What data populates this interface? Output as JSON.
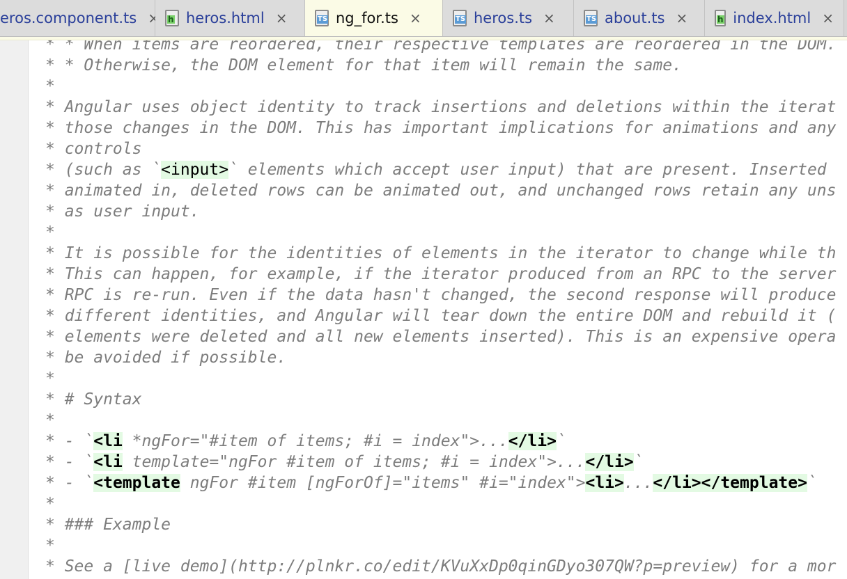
{
  "tabs": [
    {
      "label": "eros.component.ts",
      "icon": "none",
      "active": false
    },
    {
      "label": "heros.html",
      "icon": "html",
      "active": false
    },
    {
      "label": "ng_for.ts",
      "icon": "ts",
      "active": true
    },
    {
      "label": "heros.ts",
      "icon": "ts",
      "active": false
    },
    {
      "label": "about.ts",
      "icon": "ts",
      "active": false
    },
    {
      "label": "index.html",
      "icon": "html",
      "active": false
    }
  ],
  "close_glyph": "×",
  "icon_labels": {
    "ts": "TS",
    "html": "h"
  },
  "colors": {
    "comment": "#7d7d7d",
    "tag_bg": "#e3fae3",
    "active_tab": "#fbfbe6"
  },
  "lines": [
    [
      {
        "t": "* * When items are reordered, their respective templates are reordered in the DOM.",
        "k": "c"
      }
    ],
    [
      {
        "t": "* * Otherwise, the DOM element for that item will remain the same.",
        "k": "c"
      }
    ],
    [
      {
        "t": "*",
        "k": "c"
      }
    ],
    [
      {
        "t": "* Angular uses object identity to track insertions and deletions within the iterat",
        "k": "c"
      }
    ],
    [
      {
        "t": "* those changes in the DOM. This has important implications for animations and any",
        "k": "c"
      }
    ],
    [
      {
        "t": "* controls",
        "k": "c"
      }
    ],
    [
      {
        "t": "* (such as `",
        "k": "c"
      },
      {
        "t": "<input>",
        "k": "tag"
      },
      {
        "t": "` elements which accept user input) that are present. Inserted ",
        "k": "c"
      }
    ],
    [
      {
        "t": "* animated in, deleted rows can be animated out, and unchanged rows retain any uns",
        "k": "c"
      }
    ],
    [
      {
        "t": "* as user input.",
        "k": "c"
      }
    ],
    [
      {
        "t": "*",
        "k": "c"
      }
    ],
    [
      {
        "t": "* It is possible for the identities of elements in the iterator to change while th",
        "k": "c"
      }
    ],
    [
      {
        "t": "* This can happen, for example, if the iterator produced from an RPC to the server",
        "k": "c"
      }
    ],
    [
      {
        "t": "* RPC is re-run. Even if the data hasn't changed, the second response will produce",
        "k": "c"
      }
    ],
    [
      {
        "t": "* different identities, and Angular will tear down the entire DOM and rebuild it (",
        "k": "c"
      }
    ],
    [
      {
        "t": "* elements were deleted and all new elements inserted). This is an expensive opera",
        "k": "c"
      }
    ],
    [
      {
        "t": "* be avoided if possible.",
        "k": "c"
      }
    ],
    [
      {
        "t": "*",
        "k": "c"
      }
    ],
    [
      {
        "t": "* # Syntax",
        "k": "c"
      }
    ],
    [
      {
        "t": "*",
        "k": "c"
      }
    ],
    [
      {
        "t": "* - `",
        "k": "c"
      },
      {
        "t": "<li",
        "k": "tagb"
      },
      {
        "t": " *ngFor=\"#item of items; #i = index\">...",
        "k": "c"
      },
      {
        "t": "</li>",
        "k": "tagb"
      },
      {
        "t": "`",
        "k": "c"
      }
    ],
    [
      {
        "t": "* - `",
        "k": "c"
      },
      {
        "t": "<li",
        "k": "tagb"
      },
      {
        "t": " template=\"ngFor #item of items; #i = index\">...",
        "k": "c"
      },
      {
        "t": "</li>",
        "k": "tagb"
      },
      {
        "t": "`",
        "k": "c"
      }
    ],
    [
      {
        "t": "* - `",
        "k": "c"
      },
      {
        "t": "<template",
        "k": "tagb"
      },
      {
        "t": " ngFor #item [ngForOf]=\"items\" #i=\"index\">",
        "k": "c"
      },
      {
        "t": "<li>",
        "k": "tagb"
      },
      {
        "t": "...",
        "k": "c"
      },
      {
        "t": "</li></template>",
        "k": "tagb"
      },
      {
        "t": "`",
        "k": "c"
      }
    ],
    [
      {
        "t": "*",
        "k": "c"
      }
    ],
    [
      {
        "t": "* ### Example",
        "k": "c"
      }
    ],
    [
      {
        "t": "*",
        "k": "c"
      }
    ],
    [
      {
        "t": "* See a [live demo](http://plnkr.co/edit/KVuXxDp0qinGDyo307QW?p=preview) for a mor",
        "k": "c"
      }
    ]
  ]
}
